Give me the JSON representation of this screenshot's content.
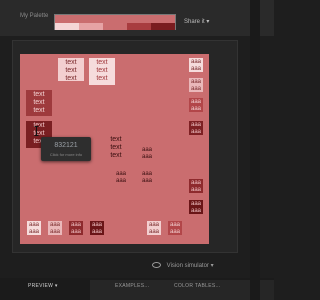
{
  "header": {
    "palette_label": "My Palette",
    "share_label": "Share it",
    "share_caret": "▾"
  },
  "palette_swatches": [
    "#f5d6d7",
    "#e6a3a5",
    "#ca6d6f",
    "#a83c3f",
    "#7a1c1f"
  ],
  "tiles": {
    "t1": {
      "l1": "text",
      "l2": "text",
      "l3": "text",
      "bg": "#f3cfd0",
      "fg": "#7a2a2c"
    },
    "t2": {
      "l1": "text",
      "l2": "text",
      "l3": "text",
      "bg": "#f6dcdc",
      "fg": "#a23a3d"
    },
    "t3": {
      "l1": "text",
      "l2": "text",
      "l3": "text",
      "bg": "#9e3a3d",
      "fg": "#f3d0d1"
    },
    "t4": {
      "l1": "text",
      "l2": "text",
      "l3": "text",
      "bg": "#7a1f22",
      "fg": "#f1c2c4"
    },
    "t5": {
      "l1": "text",
      "l2": "text",
      "l3": "text",
      "bg": "#ca6d6f",
      "fg": "#3a0f10"
    },
    "r1": {
      "l1": "aaa",
      "l2": "aaa",
      "bg": "#f6dcdc",
      "fg": "#7a2a2c"
    },
    "r2": {
      "l1": "aaa",
      "l2": "aaa",
      "bg": "#eab8ba",
      "fg": "#7a2a2c"
    },
    "r3": {
      "l1": "aaa",
      "l2": "aaa",
      "bg": "#b24649",
      "fg": "#f3d0d1"
    },
    "r4": {
      "l1": "aaa",
      "l2": "aaa",
      "bg": "#7e2023",
      "fg": "#f1c2c4"
    },
    "r5": {
      "l1": "aaa",
      "l2": "aaa",
      "bg": "#8e2a2d",
      "fg": "#f1c2c4"
    },
    "r6": {
      "l1": "aaa",
      "l2": "aaa",
      "bg": "#6a1517",
      "fg": "#f1c2c4"
    },
    "c1": {
      "l1": "aaa",
      "l2": "aaa",
      "bg": "#ca6d6f",
      "fg": "#3a0f10"
    },
    "c2": {
      "l1": "aaa",
      "l2": "aaa",
      "bg": "#ca6d6f",
      "fg": "#3a0f10"
    },
    "c3": {
      "l1": "aaa",
      "l2": "aaa",
      "bg": "#ca6d6f",
      "fg": "#3a0f10"
    },
    "b1": {
      "l1": "aaa",
      "l2": "aaa",
      "bg": "#f6dcdc",
      "fg": "#7a2a2c"
    },
    "b2": {
      "l1": "aaa",
      "l2": "aaa",
      "bg": "#eab8ba",
      "fg": "#7a2a2c"
    },
    "b3": {
      "l1": "aaa",
      "l2": "aaa",
      "bg": "#8e2a2d",
      "fg": "#f1c2c4"
    },
    "b4": {
      "l1": "aaa",
      "l2": "aaa",
      "bg": "#6a1517",
      "fg": "#f1c2c4"
    },
    "b5": {
      "l1": "aaa",
      "l2": "aaa",
      "bg": "#f3cfd0",
      "fg": "#7a2a2c"
    },
    "b6": {
      "l1": "aaa",
      "l2": "aaa",
      "bg": "#b24649",
      "fg": "#f3d0d1"
    }
  },
  "tooltip": {
    "hex": "832121",
    "hint": "Click for more info"
  },
  "vision_label": "Vision simulator",
  "vision_caret": "▾",
  "footer": {
    "preview": "PREVIEW",
    "preview_caret": "▾",
    "examples": "EXAMPLES...",
    "color_tables": "COLOR TABLES..."
  }
}
